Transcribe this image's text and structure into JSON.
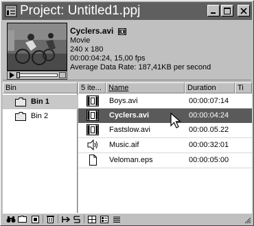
{
  "window": {
    "title": "Project: Untitled1.ppj"
  },
  "preview": {
    "clip_name": "Cyclers.avi",
    "type": "Movie",
    "dimensions": "240 x 180",
    "duration_fps": "00:00:04:24, 15,00 fps",
    "data_rate": "Average Data Rate: 187,41KB per second"
  },
  "bin_panel": {
    "header": "Bin",
    "bins": [
      {
        "label": "Bin 1",
        "selected": true
      },
      {
        "label": "Bin 2",
        "selected": false
      }
    ]
  },
  "file_panel": {
    "columns": {
      "count": "5 ite...",
      "name": "Name",
      "duration": "Duration",
      "extra": "Ti"
    },
    "rows": [
      {
        "name": "Boys.avi",
        "duration": "00:00:07:14",
        "icon": "film-icon",
        "selected": false
      },
      {
        "name": "Cyclers.avi",
        "duration": "00:00:04:24",
        "icon": "film-icon",
        "selected": true
      },
      {
        "name": "Fastslow.avi",
        "duration": "00:00.05.22",
        "icon": "film-icon",
        "selected": false
      },
      {
        "name": "Music.aif",
        "duration": "00:00:32:01",
        "icon": "speaker-icon",
        "selected": false
      },
      {
        "name": "Veloman.eps",
        "duration": "00:00:05:00",
        "icon": "document-icon",
        "selected": false
      }
    ]
  },
  "colors": {
    "titlebar": "#5f5f5f",
    "selection": "#5a5a5a",
    "chrome": "#c0c0c0"
  }
}
